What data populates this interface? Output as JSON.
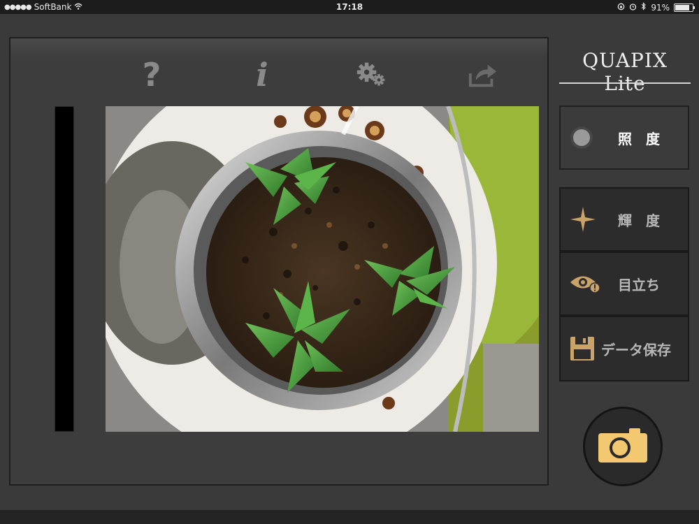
{
  "status_bar": {
    "signal_dots": "●●●●●",
    "carrier": "SoftBank",
    "time": "17:18",
    "battery": "91%",
    "battery_level": 0.91
  },
  "toolbar": {
    "icons": [
      "help-icon",
      "info-icon",
      "settings-icon",
      "share-icon"
    ],
    "help_glyph": "?",
    "info_glyph": "i"
  },
  "brand": {
    "title": "QUAPIX Lite"
  },
  "modes": {
    "illuminance": "照　度",
    "luminance": "輝　度",
    "saliency": "目立ち",
    "save": "データ保存"
  },
  "colors": {
    "accent_icon": "#c9a36a",
    "active_indicator": "#9a9a9a",
    "camera_button": "#f2c870"
  }
}
